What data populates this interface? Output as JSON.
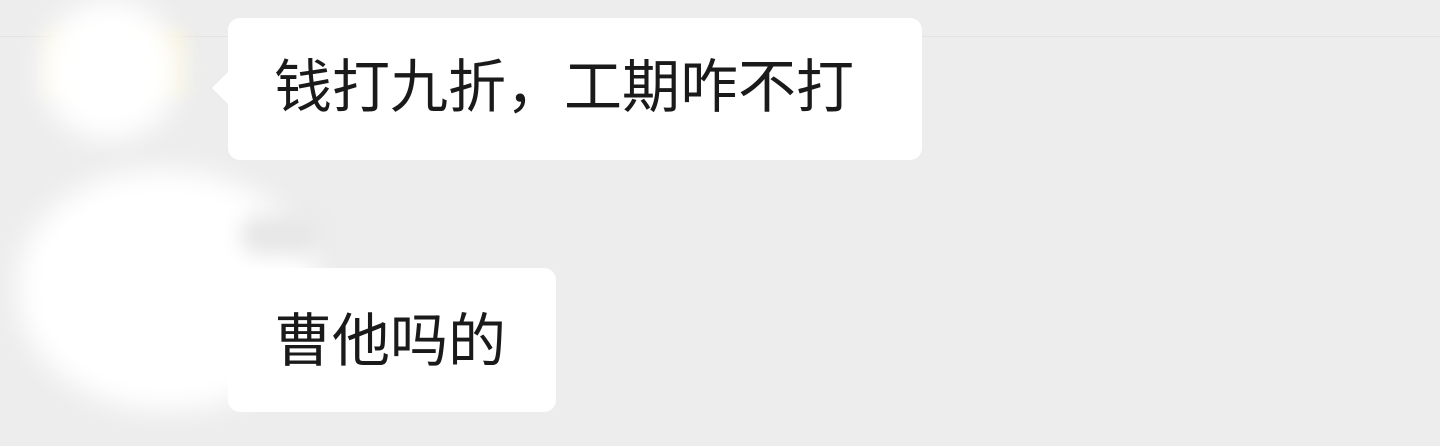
{
  "chat": {
    "messages": [
      {
        "text": "钱打九折，工期咋不打"
      },
      {
        "text": "曹他吗的"
      }
    ]
  },
  "colors": {
    "background": "#ededed",
    "bubble": "#ffffff",
    "text": "#1a1a1a"
  }
}
